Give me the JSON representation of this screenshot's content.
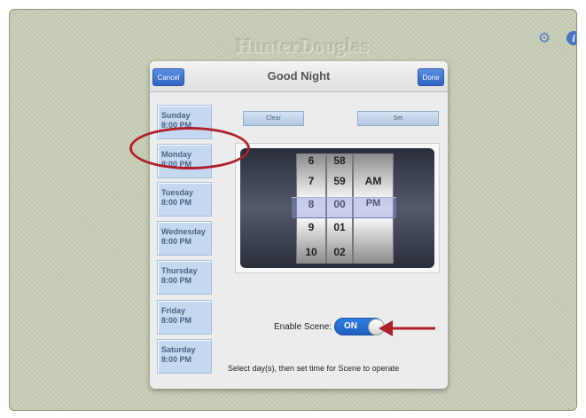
{
  "brand": "HunterDouglas",
  "header": {
    "title": "Good Night",
    "cancel_label": "Cancel",
    "done_label": "Done"
  },
  "days": [
    {
      "name": "Sunday",
      "time": "8:00 PM"
    },
    {
      "name": "Monday",
      "time": "8:00 PM"
    },
    {
      "name": "Tuesday",
      "time": "8:00 PM"
    },
    {
      "name": "Wednesday",
      "time": "8:00 PM"
    },
    {
      "name": "Thursday",
      "time": "8:00 PM"
    },
    {
      "name": "Friday",
      "time": "8:00 PM"
    },
    {
      "name": "Saturday",
      "time": "8:00 PM"
    }
  ],
  "controls": {
    "clear_label": "Clear",
    "set_label": "Set"
  },
  "picker": {
    "hours": [
      "6",
      "7",
      "8",
      "9",
      "10"
    ],
    "minutes": [
      "58",
      "59",
      "00",
      "01",
      "02"
    ],
    "periods": [
      "AM",
      "PM"
    ],
    "selected_hour": "8",
    "selected_minute": "00",
    "selected_period": "PM"
  },
  "enable_scene": {
    "label": "Enable Scene:",
    "state": "ON"
  },
  "hint": "Select day(s), then set time for Scene to operate",
  "icons": {
    "settings": "gear-icon",
    "info": "info-icon"
  },
  "colors": {
    "accent": "#2f63c4",
    "annotation": "#b0202a",
    "background": "#c7ceb6"
  }
}
